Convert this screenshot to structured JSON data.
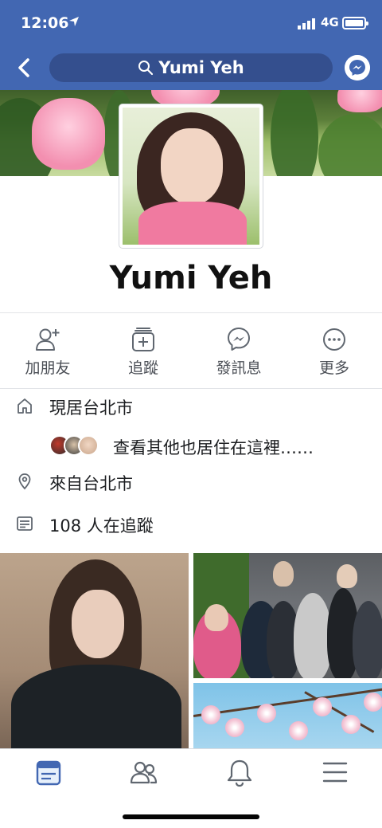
{
  "status_bar": {
    "time": "12:06",
    "network": "4G"
  },
  "nav": {
    "search_text": "Yumi Yeh",
    "icons": [
      "back-arrow-icon",
      "search-icon",
      "messenger-icon"
    ]
  },
  "profile": {
    "name": "Yumi Yeh"
  },
  "actions": [
    {
      "label": "加朋友",
      "icon": "add-friend-icon"
    },
    {
      "label": "追蹤",
      "icon": "follow-icon"
    },
    {
      "label": "發訊息",
      "icon": "message-icon"
    },
    {
      "label": "更多",
      "icon": "more-icon"
    }
  ],
  "intro": {
    "lives_in": "現居台北市",
    "see_others": "查看其他也居住在這裡……",
    "from": "來自台北市",
    "followers": "108 人在追蹤"
  },
  "tabbar": {
    "tabs": [
      "news-feed-icon",
      "friends-icon",
      "notifications-icon",
      "menu-icon"
    ],
    "active": "news-feed-icon"
  },
  "colors": {
    "brand": "#4267b2",
    "search_pill": "#344f8e",
    "text": "#1c1e21",
    "secondary_text": "#4b4f56",
    "icon_gray": "#606770"
  }
}
